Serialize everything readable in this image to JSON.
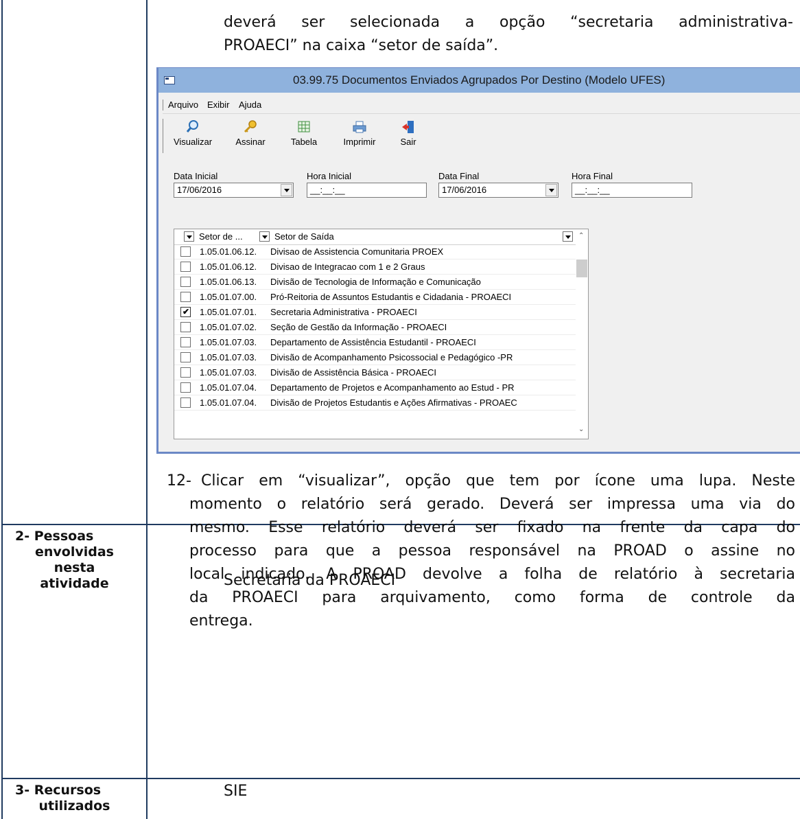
{
  "intro_text": [
    "deverá ser selecionada a opção “secretaria administrativa-",
    "PROAECI” na caixa “setor de saída”."
  ],
  "window": {
    "title": "03.99.75 Documentos Enviados Agrupados Por Destino (Modelo UFES)",
    "menu": [
      "Arquivo",
      "Exibir",
      "Ajuda"
    ],
    "toolbar": [
      {
        "label": "Visualizar",
        "icon": "magnifier-icon"
      },
      {
        "label": "Assinar",
        "icon": "key-icon"
      },
      {
        "label": "Tabela",
        "icon": "table-icon"
      },
      {
        "label": "Imprimir",
        "icon": "printer-icon"
      },
      {
        "label": "Sair",
        "icon": "exit-door-icon"
      }
    ],
    "fields": {
      "data_inicial_label": "Data Inicial",
      "data_inicial_value": "17/06/2016",
      "hora_inicial_label": "Hora Inicial",
      "hora_inicial_value": "__:__:__",
      "data_final_label": "Data Final",
      "data_final_value": "17/06/2016",
      "hora_final_label": "Hora Final",
      "hora_final_value": "__:__:__"
    },
    "grid": {
      "col1": "Setor de ...",
      "col2": "Setor de Saída",
      "rows": [
        {
          "checked": false,
          "code": "1.05.01.06.12.",
          "name": "Divisao de Assistencia Comunitaria PROEX"
        },
        {
          "checked": false,
          "code": "1.05.01.06.12.",
          "name": "Divisao de Integracao com 1 e 2 Graus"
        },
        {
          "checked": false,
          "code": "1.05.01.06.13.",
          "name": "Divisão de Tecnologia de Informação e Comunicação"
        },
        {
          "checked": false,
          "code": "1.05.01.07.00.",
          "name": "Pró-Reitoria de Assuntos Estudantis e Cidadania - PROAECI"
        },
        {
          "checked": true,
          "code": "1.05.01.07.01.",
          "name": "Secretaria Administrativa - PROAECI"
        },
        {
          "checked": false,
          "code": "1.05.01.07.02.",
          "name": "Seção de Gestão da Informação - PROAECI"
        },
        {
          "checked": false,
          "code": "1.05.01.07.03.",
          "name": "Departamento de Assistência Estudantil - PROAECI"
        },
        {
          "checked": false,
          "code": "1.05.01.07.03.",
          "name": "Divisão de Acompanhamento Psicossocial e Pedagógico -PR"
        },
        {
          "checked": false,
          "code": "1.05.01.07.03.",
          "name": "Divisão de Assistência Básica - PROAECI"
        },
        {
          "checked": false,
          "code": "1.05.01.07.04.",
          "name": "Departamento de Projetos e Acompanhamento ao Estud - PR"
        },
        {
          "checked": false,
          "code": "1.05.01.07.04.",
          "name": "Divisão de Projetos Estudantis e Ações Afirmativas - PROAEC"
        }
      ]
    }
  },
  "step12": {
    "number": "12-",
    "lines": [
      "Clicar em “visualizar”, opção que tem por ícone uma lupa. Neste",
      "momento o relatório será gerado. Deverá ser impressa uma via do",
      "mesmo. Esse relatório deverá ser fixado na frente da capa do",
      "processo para que a pessoa responsável na PROAD o assine no",
      "local indicado. A PROAD devolve a folha de relatório à secretaria",
      "da PROAECI para arquivamento, como forma de controle da",
      "entrega."
    ]
  },
  "section2": {
    "label_lines": [
      "2-  Pessoas",
      "envolvidas",
      "nesta",
      "atividade"
    ],
    "value": "Secretaria da PROAECI"
  },
  "section3": {
    "label_lines": [
      "3-  Recursos",
      "utilizados"
    ],
    "value": "SIE"
  }
}
